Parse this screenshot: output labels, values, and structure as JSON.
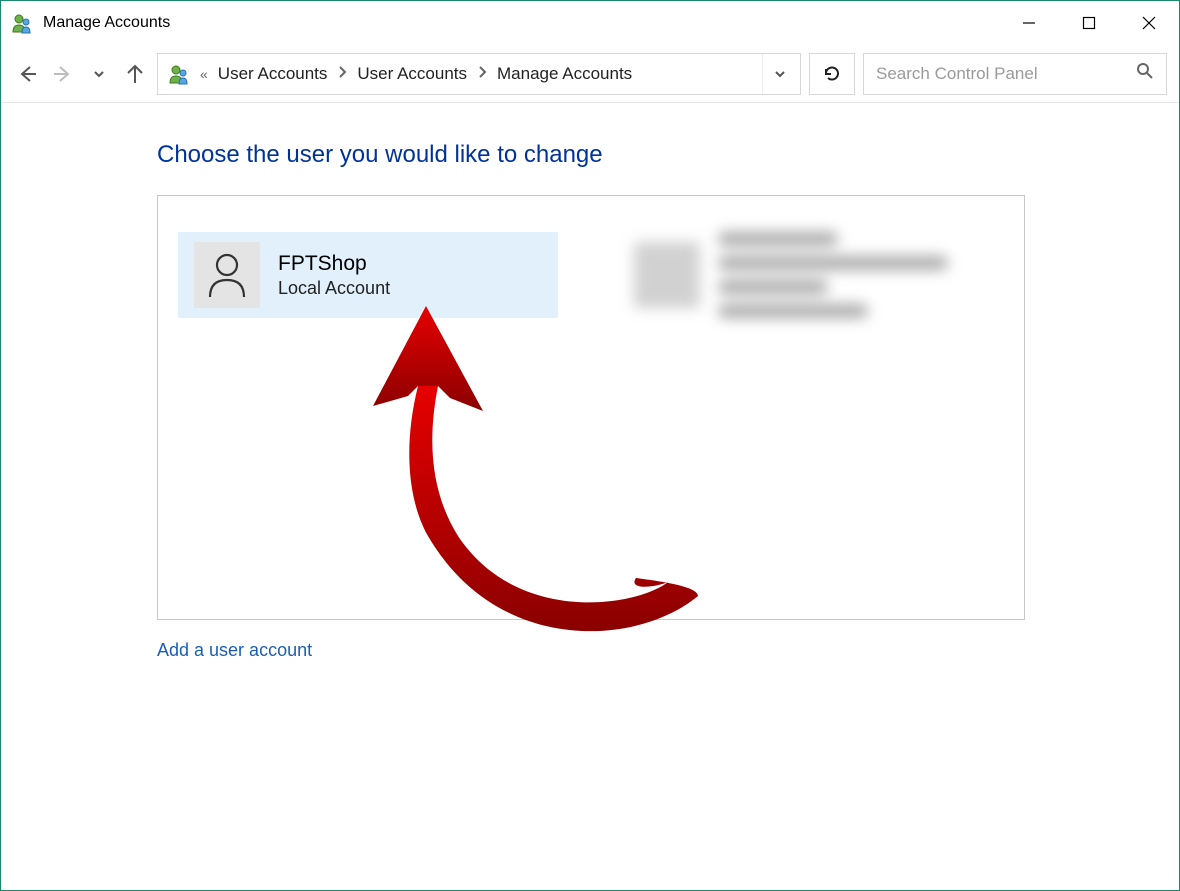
{
  "window": {
    "title": "Manage Accounts"
  },
  "breadcrumb": {
    "items": [
      "User Accounts",
      "User Accounts",
      "Manage Accounts"
    ]
  },
  "search": {
    "placeholder": "Search Control Panel"
  },
  "main": {
    "heading": "Choose the user you would like to change",
    "accounts": [
      {
        "name": "FPTShop",
        "type": "Local Account",
        "selected": true
      }
    ],
    "add_link": "Add a user account"
  }
}
